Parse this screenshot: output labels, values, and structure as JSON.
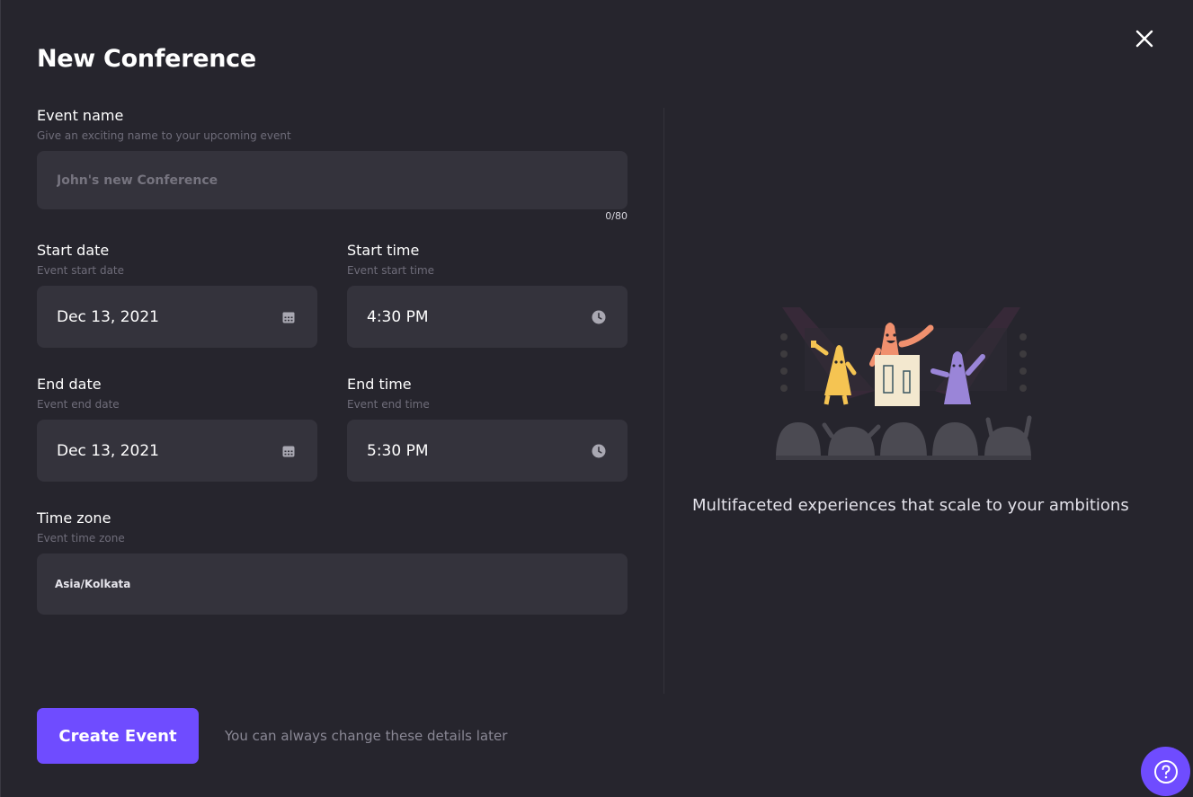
{
  "modal": {
    "title": "New Conference",
    "close_icon": "close-icon"
  },
  "event_name": {
    "label": "Event name",
    "hint": "Give an exciting name to your upcoming event",
    "value": "",
    "placeholder": "John's new Conference",
    "counter": "0/80"
  },
  "start_date": {
    "label": "Start date",
    "hint": "Event start date",
    "value": "Dec 13, 2021",
    "icon": "calendar-icon"
  },
  "start_time": {
    "label": "Start time",
    "hint": "Event start time",
    "value": "4:30 PM",
    "icon": "clock-icon"
  },
  "end_date": {
    "label": "End date",
    "hint": "Event end date",
    "value": "Dec 13, 2021",
    "icon": "calendar-icon"
  },
  "end_time": {
    "label": "End time",
    "hint": "Event end time",
    "value": "5:30 PM",
    "icon": "clock-icon"
  },
  "time_zone": {
    "label": "Time zone",
    "hint": "Event time zone",
    "value": "Asia/Kolkata"
  },
  "side_panel": {
    "tagline": "Multifaceted experiences that scale to your ambitions"
  },
  "footer": {
    "create_label": "Create Event",
    "note": "You can always change these details later"
  },
  "help": {
    "icon": "question-icon"
  },
  "colors": {
    "background": "#26252d",
    "input_bg": "#34333c",
    "accent": "#6f4cff"
  }
}
